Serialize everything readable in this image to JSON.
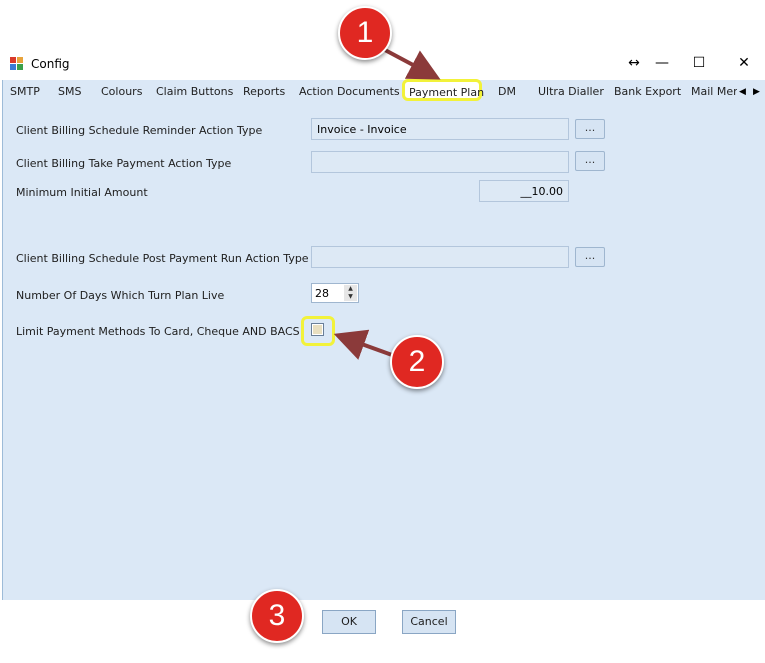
{
  "window": {
    "title": "Config"
  },
  "window_controls": {
    "resize": "↔",
    "minimize": "—",
    "maximize": "☐",
    "close": "✕"
  },
  "tabs": [
    {
      "label": "SMTP"
    },
    {
      "label": "SMS"
    },
    {
      "label": "Colours"
    },
    {
      "label": "Claim Buttons"
    },
    {
      "label": "Reports"
    },
    {
      "label": "Action Documents"
    },
    {
      "label": "Payment Plan",
      "active": true
    },
    {
      "label": "DM"
    },
    {
      "label": "Ultra Dialler"
    },
    {
      "label": "Bank Export"
    },
    {
      "label": "Mail Mer"
    }
  ],
  "tab_scroll": {
    "left": "◀",
    "right": "▶"
  },
  "form": {
    "reminder_action_label": "Client Billing Schedule Reminder Action Type",
    "reminder_action_value": "Invoice - Invoice",
    "take_payment_label": "Client Billing Take Payment Action Type",
    "take_payment_value": "",
    "min_amount_label": "Minimum Initial Amount",
    "min_amount_value": "__10.00",
    "post_payment_label": "Client Billing Schedule Post Payment Run Action Type",
    "post_payment_value": "",
    "days_live_label": "Number Of Days Which Turn Plan Live",
    "days_live_value": "28",
    "limit_methods_label": "Limit Payment Methods To Card, Cheque AND BACS",
    "limit_methods_checked": false,
    "browse_label": "..."
  },
  "buttons": {
    "ok": "OK",
    "cancel": "Cancel"
  },
  "annotations": {
    "step1": "1",
    "step2": "2",
    "step3": "3"
  },
  "colors": {
    "badge": "#e02822",
    "highlight": "#f2f23a",
    "arrow": "#8b3a3a",
    "panel": "#dbe8f6"
  }
}
